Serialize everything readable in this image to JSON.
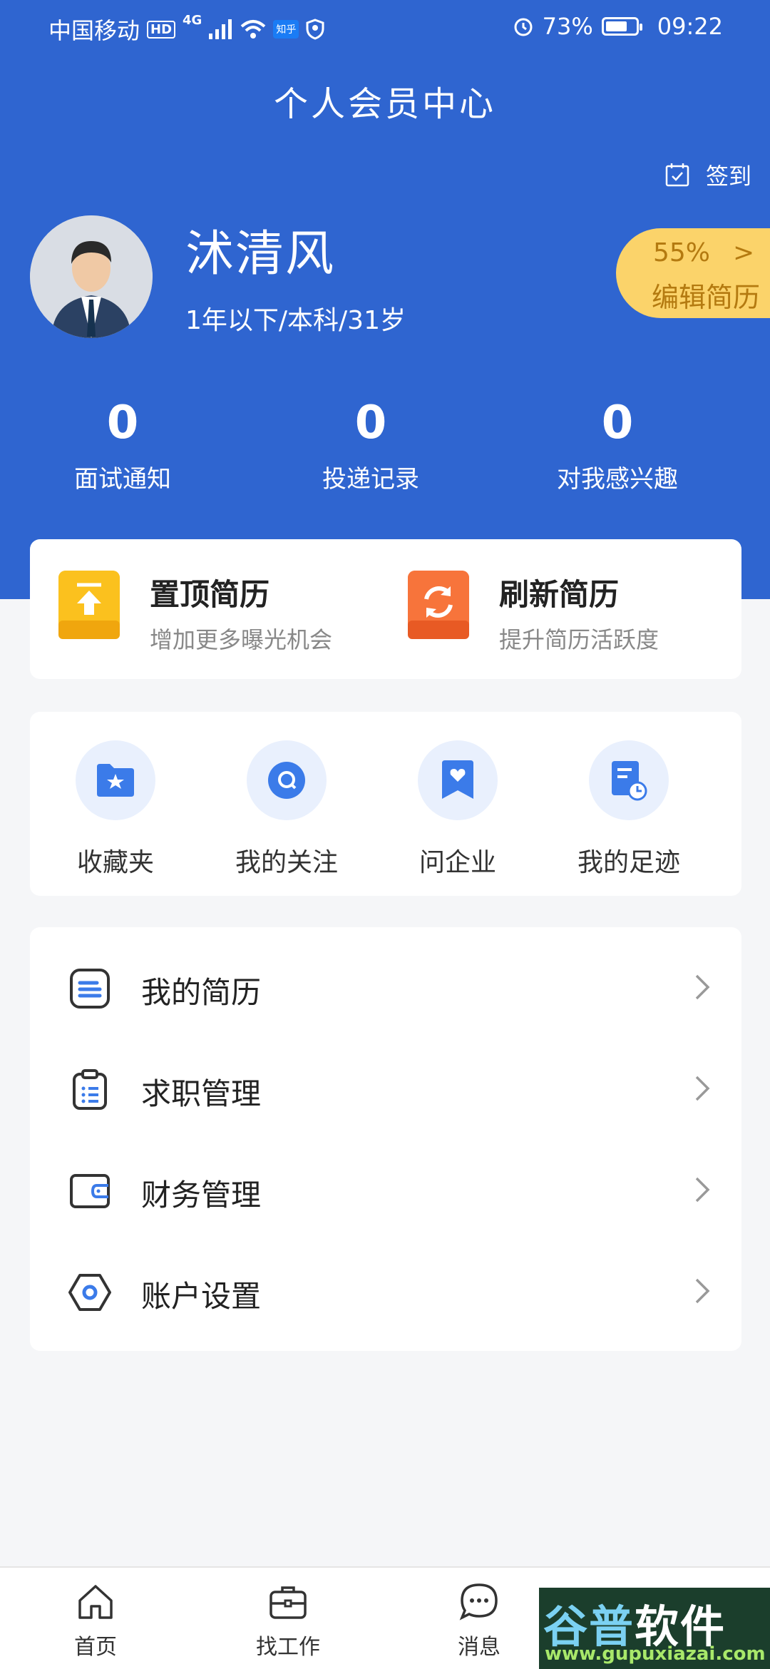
{
  "status_bar": {
    "carrier": "中国移动",
    "hd_badge": "HD",
    "network": "4G",
    "app_badge": "知乎",
    "battery": "73%",
    "battery_level": 0.73,
    "time": "09:22"
  },
  "header": {
    "title": "个人会员中心",
    "signin_label": "签到"
  },
  "profile": {
    "name": "沭清风",
    "meta": "1年以下/本科/31岁",
    "resume_percent": "55%",
    "resume_arrow": ">",
    "edit_resume_label": "编辑简历"
  },
  "stats": [
    {
      "value": "0",
      "label": "面试通知"
    },
    {
      "value": "0",
      "label": "投递记录"
    },
    {
      "value": "0",
      "label": "对我感兴趣"
    }
  ],
  "promo": [
    {
      "title": "置顶简历",
      "subtitle": "增加更多曝光机会",
      "icon": "pin-top-icon",
      "color": "#fbc11e"
    },
    {
      "title": "刷新简历",
      "subtitle": "提升简历活跃度",
      "icon": "refresh-icon",
      "color": "#f7743b"
    }
  ],
  "quick_links": [
    {
      "label": "收藏夹",
      "icon": "favorites-folder-icon"
    },
    {
      "label": "我的关注",
      "icon": "follow-icon"
    },
    {
      "label": "问企业",
      "icon": "ask-company-icon"
    },
    {
      "label": "我的足迹",
      "icon": "history-icon"
    }
  ],
  "menu": [
    {
      "label": "我的简历",
      "icon": "resume-icon"
    },
    {
      "label": "求职管理",
      "icon": "clipboard-icon"
    },
    {
      "label": "财务管理",
      "icon": "wallet-icon"
    },
    {
      "label": "账户设置",
      "icon": "settings-hex-icon"
    }
  ],
  "tabbar": [
    {
      "label": "首页",
      "icon": "home-icon"
    },
    {
      "label": "找工作",
      "icon": "briefcase-icon"
    },
    {
      "label": "消息",
      "icon": "message-icon"
    }
  ],
  "watermark": {
    "text_a": "谷普",
    "text_b": "软件园",
    "url": "www.gupuxiazai.com"
  },
  "colors": {
    "primary": "#2f65d0",
    "accent_yellow": "#fbd36a",
    "background": "#f5f6f8"
  }
}
